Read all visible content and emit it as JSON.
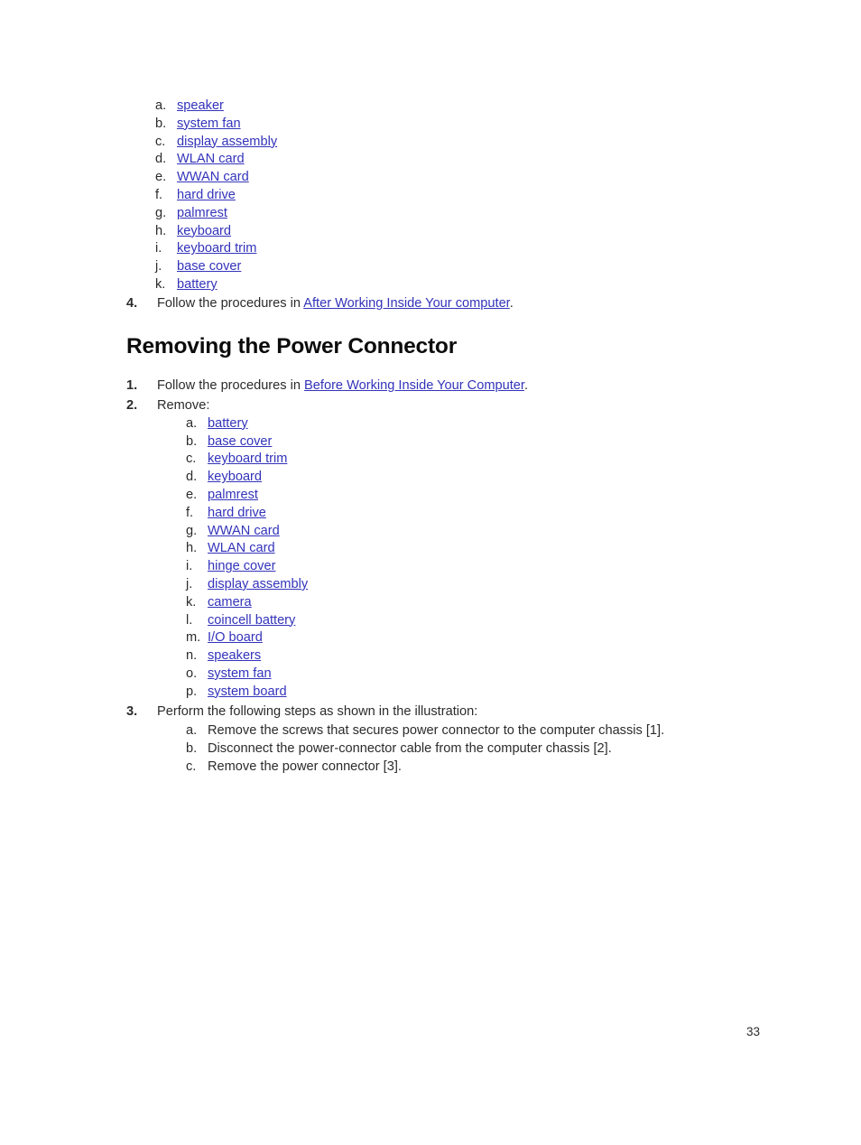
{
  "page": {
    "number": "33",
    "link_color": "#3333bb",
    "text_color": "#2b2b2b"
  },
  "top_continuation": {
    "items": [
      {
        "marker": "a.",
        "label": "speaker",
        "is_link": true
      },
      {
        "marker": "b.",
        "label": "system fan",
        "is_link": true
      },
      {
        "marker": "c.",
        "label": "display assembly",
        "is_link": true
      },
      {
        "marker": "d.",
        "label": "WLAN card",
        "is_link": true
      },
      {
        "marker": "e.",
        "label": "WWAN card",
        "is_link": true
      },
      {
        "marker": "f.",
        "label": "hard drive",
        "is_link": true
      },
      {
        "marker": "g.",
        "label": "palmrest",
        "is_link": true
      },
      {
        "marker": "h.",
        "label": "keyboard",
        "is_link": true
      },
      {
        "marker": "i.",
        "label": "keyboard trim",
        "is_link": true
      },
      {
        "marker": "j.",
        "label": "base cover",
        "is_link": true
      },
      {
        "marker": "k.",
        "label": "battery",
        "is_link": true
      }
    ],
    "final_step": {
      "marker": "4.",
      "text_before": "Follow the procedures in ",
      "link": "After Working Inside Your computer",
      "text_after": "."
    }
  },
  "section": {
    "title": "Removing the Power Connector",
    "step1": {
      "marker": "1.",
      "text_before": "Follow the procedures in ",
      "link": "Before Working Inside Your Computer",
      "text_after": "."
    },
    "step2": {
      "marker": "2.",
      "text": "Remove:",
      "items": [
        {
          "marker": "a.",
          "label": "battery"
        },
        {
          "marker": "b.",
          "label": "base cover"
        },
        {
          "marker": "c.",
          "label": "keyboard trim"
        },
        {
          "marker": "d.",
          "label": "keyboard"
        },
        {
          "marker": "e.",
          "label": "palmrest"
        },
        {
          "marker": "f.",
          "label": "hard drive"
        },
        {
          "marker": "g.",
          "label": "WWAN card"
        },
        {
          "marker": "h.",
          "label": "WLAN card"
        },
        {
          "marker": "i.",
          "label": "hinge cover"
        },
        {
          "marker": "j.",
          "label": "display assembly"
        },
        {
          "marker": "k.",
          "label": "camera"
        },
        {
          "marker": "l.",
          "label": "coincell battery"
        },
        {
          "marker": "m.",
          "label": "I/O board"
        },
        {
          "marker": "n.",
          "label": "speakers"
        },
        {
          "marker": "o.",
          "label": "system fan"
        },
        {
          "marker": "p.",
          "label": "system board"
        }
      ]
    },
    "step3": {
      "marker": "3.",
      "text": "Perform the following steps as shown in the illustration:",
      "items": [
        {
          "marker": "a.",
          "label": "Remove the screws that secures power connector to the computer chassis [1]."
        },
        {
          "marker": "b.",
          "label": "Disconnect the power-connector cable from the computer chassis [2]."
        },
        {
          "marker": "c.",
          "label": "Remove the power connector [3]."
        }
      ]
    }
  }
}
